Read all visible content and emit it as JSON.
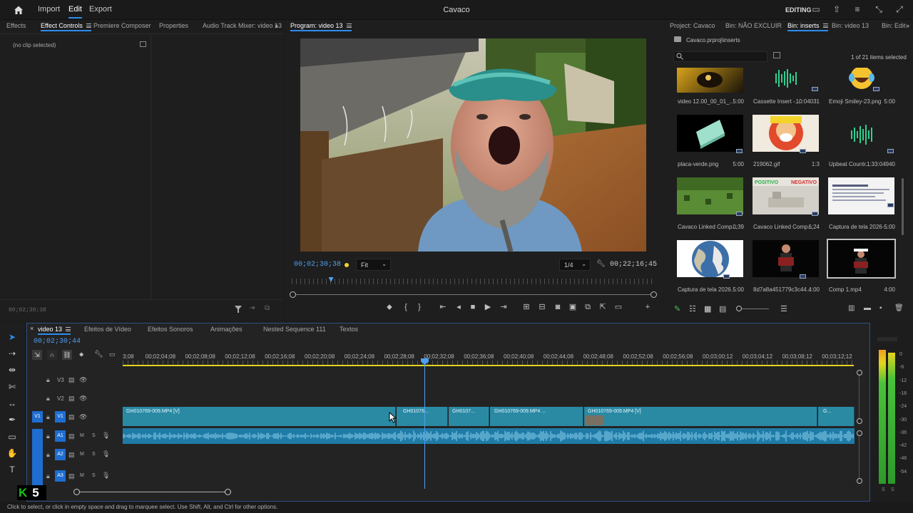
{
  "app": {
    "title": "Cavaco",
    "workspace": "EDITING"
  },
  "menu": {
    "home": "home",
    "import": "Import",
    "edit": "Edit",
    "export": "Export"
  },
  "left_panel": {
    "tabs": [
      "Effects",
      "Effect Controls",
      "Premiere Composer",
      "Properties",
      "Audio Track Mixer: video 13"
    ],
    "active_tab": "Effect Controls",
    "no_clip": "(no clip selected)",
    "timecode": "00;02;30;38"
  },
  "program": {
    "tab": "Program: video 13",
    "timecode": "00;02;30;38",
    "fit": "Fit",
    "resolution": "1/4",
    "duration": "00;22;16;45",
    "playhead_fraction": 0.105
  },
  "project": {
    "tabs": [
      "Project: Cavaco",
      "Bin: NÃO EXCLUIR",
      "Bin: inserts",
      "Bin: video 13",
      "Bin: Edit"
    ],
    "active_tab": "Bin: inserts",
    "path": "Cavaco.prproj\\inserts",
    "items_selected": "1 of 21 items selected",
    "items": [
      {
        "name": "video 12.00_00_01_...",
        "duration": "5:00"
      },
      {
        "name": "Cassette Insert -...",
        "duration": "10:04031"
      },
      {
        "name": "Emoji Smiley-23.png",
        "duration": "5:00"
      },
      {
        "name": "placa-verde.png",
        "duration": "5:00"
      },
      {
        "name": "219062.gif",
        "duration": "1:3"
      },
      {
        "name": "Upbeat Countr...",
        "duration": "1:33:04940"
      },
      {
        "name": "Cavaco Linked Comp...",
        "duration": "0;39"
      },
      {
        "name": "Cavaco Linked Comp...",
        "duration": "6;24"
      },
      {
        "name": "Captura de tela 2026-...",
        "duration": "5:00"
      },
      {
        "name": "Captura de tela 2026...",
        "duration": "5:00"
      },
      {
        "name": "8d7a8a451779c3c44...",
        "duration": "4:00"
      },
      {
        "name": "Comp 1.mp4",
        "duration": "4:00"
      }
    ],
    "thumb_overlay": {
      "positivo": "POSITIVO",
      "negativo": "NEGATIVO"
    }
  },
  "timeline": {
    "tabs": [
      "video 13",
      "Efeitos de Vídeo",
      "Efeitos Sonoros",
      "Animações",
      "Nested Sequence 111",
      "Textos"
    ],
    "active_tab": "video 13",
    "timecode": "00;02;30;44",
    "ruler": [
      "3;08",
      "00;02;04;08",
      "00;02;08;08",
      "00;02;12;08",
      "00;02;16;08",
      "00;02;20;08",
      "00;02;24;08",
      "00;02;28;08",
      "00;02;32;08",
      "00;02;36;08",
      "00;02;40;08",
      "00;02;44;08",
      "00;02;48;08",
      "00;02;52;08",
      "00;02;56;08",
      "00;03;00;12",
      "00;03;04;12",
      "00;03;08;12",
      "00;03;12;12"
    ],
    "tracks": {
      "v3": "V3",
      "v2": "V2",
      "v1": "V1",
      "v1_src": "V1",
      "a1": "A1",
      "a2": "A2",
      "a3": "A3",
      "m": "M",
      "s": "S"
    },
    "clips": [
      {
        "name": "GH010769-009.MP4 [V]"
      },
      {
        "name": "GH01076..."
      },
      {
        "name": "GH0107..."
      },
      {
        "name": "GH010769-009.MP4 ..."
      },
      {
        "name": "GH010769-009.MP4 [V]"
      },
      {
        "name": "G..."
      }
    ],
    "meter_labels": [
      "0",
      "-6",
      "-12",
      "-18",
      "-24",
      "-30",
      "-36",
      "-42",
      "-48",
      "-54"
    ],
    "meter_sl": [
      "S",
      "S"
    ]
  },
  "status_bar": "Click to select, or click in empty space and drag to marquee select. Use Shift, Alt, and Ctrl for other options.",
  "watermark": "K5",
  "colors": {
    "accent": "#2d8ceb",
    "clip": "#2a8aa3",
    "audio": "#2b8dc4"
  }
}
